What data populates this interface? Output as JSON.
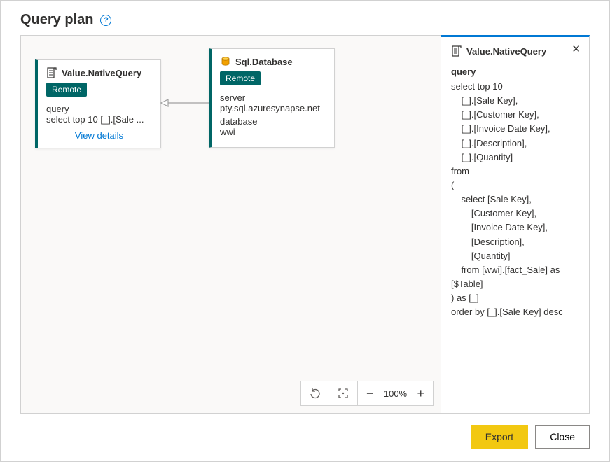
{
  "header": {
    "title": "Query plan"
  },
  "canvas": {
    "nodes": [
      {
        "title": "Value.NativeQuery",
        "badge": "Remote",
        "param_label": "query",
        "param_value": "select top 10 [_].[Sale ...",
        "link_label": "View details"
      },
      {
        "title": "Sql.Database",
        "badge": "Remote",
        "server_label": "server",
        "server_value": "pty.sql.azuresynapse.net",
        "database_label": "database",
        "database_value": "wwi"
      }
    ],
    "zoom": {
      "level": "100%"
    }
  },
  "panel": {
    "title": "Value.NativeQuery",
    "label": "query",
    "sql": "select top 10\n    [_].[Sale Key],\n    [_].[Customer Key],\n    [_].[Invoice Date Key],\n    [_].[Description],\n    [_].[Quantity]\nfrom\n(\n    select [Sale Key],\n        [Customer Key],\n        [Invoice Date Key],\n        [Description],\n        [Quantity]\n    from [wwi].[fact_Sale] as [$Table]\n) as [_]\norder by [_].[Sale Key] desc"
  },
  "footer": {
    "export": "Export",
    "close": "Close"
  }
}
